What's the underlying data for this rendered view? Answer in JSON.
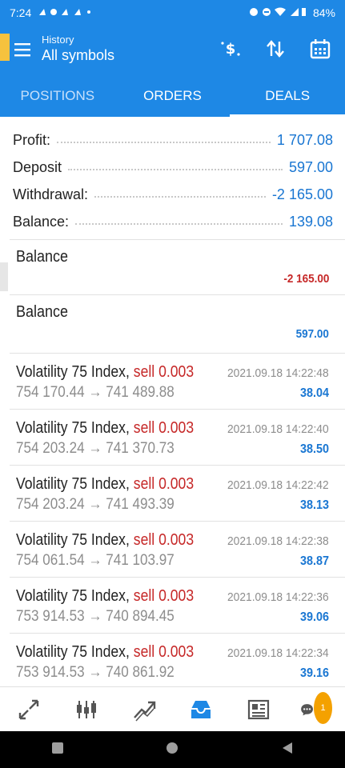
{
  "status_bar": {
    "time": "7:24",
    "battery": "84%"
  },
  "app_bar": {
    "subtitle": "History",
    "title": "All symbols"
  },
  "tabs": [
    {
      "label": "POSITIONS",
      "active": false
    },
    {
      "label": "ORDERS",
      "active": false
    },
    {
      "label": "DEALS",
      "active": true
    }
  ],
  "summary": {
    "profit": {
      "label": "Profit:",
      "value": "1 707.08"
    },
    "deposit": {
      "label": "Deposit",
      "value": "597.00"
    },
    "withdrawal": {
      "label": "Withdrawal:",
      "value": "-2 165.00"
    },
    "balance": {
      "label": "Balance:",
      "value": "139.08"
    }
  },
  "balance_ops": [
    {
      "title": "Balance",
      "amount": "-2 165.00"
    },
    {
      "title": "Balance",
      "amount": "597.00"
    }
  ],
  "deals": [
    {
      "symbol": "Volatility 75 Index,",
      "side": "sell 0.003",
      "time": "2021.09.18 14:22:48",
      "open": "754 170.44",
      "arrow": "→",
      "close": "741 489.88",
      "profit": "38.04"
    },
    {
      "symbol": "Volatility 75 Index,",
      "side": "sell 0.003",
      "time": "2021.09.18 14:22:40",
      "open": "754 203.24",
      "arrow": "→",
      "close": "741 370.73",
      "profit": "38.50"
    },
    {
      "symbol": "Volatility 75 Index,",
      "side": "sell 0.003",
      "time": "2021.09.18 14:22:42",
      "open": "754 203.24",
      "arrow": "→",
      "close": "741 493.39",
      "profit": "38.13"
    },
    {
      "symbol": "Volatility 75 Index,",
      "side": "sell 0.003",
      "time": "2021.09.18 14:22:38",
      "open": "754 061.54",
      "arrow": "→",
      "close": "741 103.97",
      "profit": "38.87"
    },
    {
      "symbol": "Volatility 75 Index,",
      "side": "sell 0.003",
      "time": "2021.09.18 14:22:36",
      "open": "753 914.53",
      "arrow": "→",
      "close": "740 894.45",
      "profit": "39.06"
    },
    {
      "symbol": "Volatility 75 Index,",
      "side": "sell 0.003",
      "time": "2021.09.18 14:22:34",
      "open": "753 914.53",
      "arrow": "→",
      "close": "740 861.92",
      "profit": "39.16"
    }
  ],
  "bottom_nav": {
    "chat_badge": "1"
  },
  "colors": {
    "primary": "#1e88e5",
    "value_blue": "#1976d2",
    "sell_red": "#c62828",
    "muted": "#8d8d8d"
  }
}
